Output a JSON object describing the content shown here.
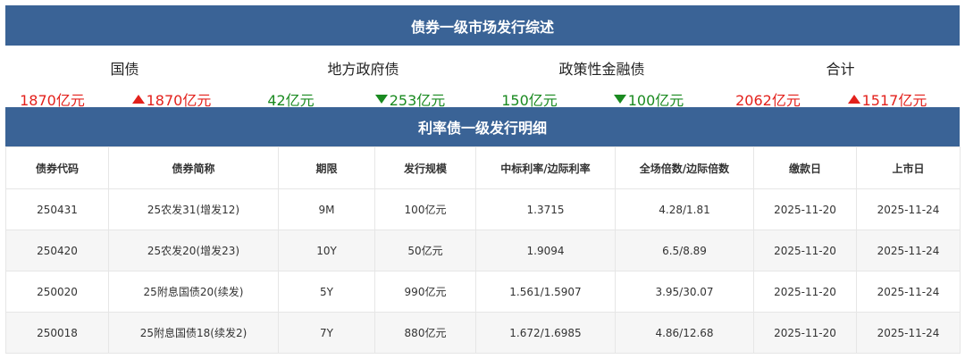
{
  "header": {
    "title": "债券一级市场发行综述"
  },
  "summary": [
    {
      "name": "国债",
      "value": "1870亿元",
      "change": "1870亿元",
      "direction": "up"
    },
    {
      "name": "地方政府债",
      "value": "42亿元",
      "change": "253亿元",
      "direction": "down"
    },
    {
      "name": "政策性金融债",
      "value": "150亿元",
      "change": "100亿元",
      "direction": "down"
    },
    {
      "name": "合计",
      "value": "2062亿元",
      "change": "1517亿元",
      "direction": "up"
    }
  ],
  "detail": {
    "title": "利率债一级发行明细",
    "columns": [
      "债券代码",
      "债券简称",
      "期限",
      "发行规模",
      "中标利率/边际利率",
      "全场倍数/边际倍数",
      "缴款日",
      "上市日"
    ],
    "rows": [
      [
        "250431",
        "25农发31(增发12)",
        "9M",
        "100亿元",
        "1.3715",
        "4.28/1.81",
        "2025-11-20",
        "2025-11-24"
      ],
      [
        "250420",
        "25农发20(增发23)",
        "10Y",
        "50亿元",
        "1.9094",
        "6.5/8.89",
        "2025-11-20",
        "2025-11-24"
      ],
      [
        "250020",
        "25附息国债20(续发)",
        "5Y",
        "990亿元",
        "1.561/1.5907",
        "3.95/30.07",
        "2025-11-20",
        "2025-11-24"
      ],
      [
        "250018",
        "25附息国债18(续发2)",
        "7Y",
        "880亿元",
        "1.672/1.6985",
        "4.86/12.68",
        "2025-11-20",
        "2025-11-24"
      ]
    ]
  },
  "colors": {
    "header_bg": "#3a6396",
    "up": "#e3211c",
    "down": "#1a8a20",
    "row_alt": "#f6f6f6",
    "border": "#e6e6e6"
  },
  "icons": {
    "up": "triangle-up-icon",
    "down": "triangle-down-icon"
  }
}
